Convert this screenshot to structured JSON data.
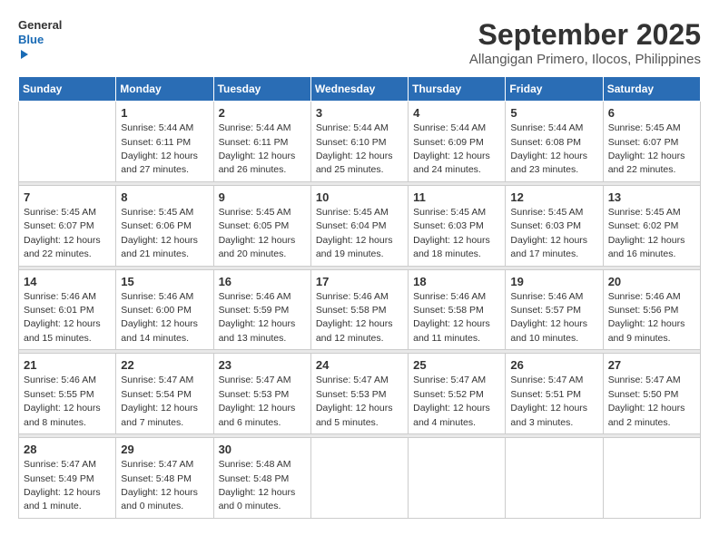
{
  "logo": {
    "line1": "General",
    "line2": "Blue"
  },
  "title": "September 2025",
  "subtitle": "Allangigan Primero, Ilocos, Philippines",
  "headers": [
    "Sunday",
    "Monday",
    "Tuesday",
    "Wednesday",
    "Thursday",
    "Friday",
    "Saturday"
  ],
  "weeks": [
    [
      {
        "day": "",
        "text": ""
      },
      {
        "day": "1",
        "text": "Sunrise: 5:44 AM\nSunset: 6:11 PM\nDaylight: 12 hours\nand 27 minutes."
      },
      {
        "day": "2",
        "text": "Sunrise: 5:44 AM\nSunset: 6:11 PM\nDaylight: 12 hours\nand 26 minutes."
      },
      {
        "day": "3",
        "text": "Sunrise: 5:44 AM\nSunset: 6:10 PM\nDaylight: 12 hours\nand 25 minutes."
      },
      {
        "day": "4",
        "text": "Sunrise: 5:44 AM\nSunset: 6:09 PM\nDaylight: 12 hours\nand 24 minutes."
      },
      {
        "day": "5",
        "text": "Sunrise: 5:44 AM\nSunset: 6:08 PM\nDaylight: 12 hours\nand 23 minutes."
      },
      {
        "day": "6",
        "text": "Sunrise: 5:45 AM\nSunset: 6:07 PM\nDaylight: 12 hours\nand 22 minutes."
      }
    ],
    [
      {
        "day": "7",
        "text": "Sunrise: 5:45 AM\nSunset: 6:07 PM\nDaylight: 12 hours\nand 22 minutes."
      },
      {
        "day": "8",
        "text": "Sunrise: 5:45 AM\nSunset: 6:06 PM\nDaylight: 12 hours\nand 21 minutes."
      },
      {
        "day": "9",
        "text": "Sunrise: 5:45 AM\nSunset: 6:05 PM\nDaylight: 12 hours\nand 20 minutes."
      },
      {
        "day": "10",
        "text": "Sunrise: 5:45 AM\nSunset: 6:04 PM\nDaylight: 12 hours\nand 19 minutes."
      },
      {
        "day": "11",
        "text": "Sunrise: 5:45 AM\nSunset: 6:03 PM\nDaylight: 12 hours\nand 18 minutes."
      },
      {
        "day": "12",
        "text": "Sunrise: 5:45 AM\nSunset: 6:03 PM\nDaylight: 12 hours\nand 17 minutes."
      },
      {
        "day": "13",
        "text": "Sunrise: 5:45 AM\nSunset: 6:02 PM\nDaylight: 12 hours\nand 16 minutes."
      }
    ],
    [
      {
        "day": "14",
        "text": "Sunrise: 5:46 AM\nSunset: 6:01 PM\nDaylight: 12 hours\nand 15 minutes."
      },
      {
        "day": "15",
        "text": "Sunrise: 5:46 AM\nSunset: 6:00 PM\nDaylight: 12 hours\nand 14 minutes."
      },
      {
        "day": "16",
        "text": "Sunrise: 5:46 AM\nSunset: 5:59 PM\nDaylight: 12 hours\nand 13 minutes."
      },
      {
        "day": "17",
        "text": "Sunrise: 5:46 AM\nSunset: 5:58 PM\nDaylight: 12 hours\nand 12 minutes."
      },
      {
        "day": "18",
        "text": "Sunrise: 5:46 AM\nSunset: 5:58 PM\nDaylight: 12 hours\nand 11 minutes."
      },
      {
        "day": "19",
        "text": "Sunrise: 5:46 AM\nSunset: 5:57 PM\nDaylight: 12 hours\nand 10 minutes."
      },
      {
        "day": "20",
        "text": "Sunrise: 5:46 AM\nSunset: 5:56 PM\nDaylight: 12 hours\nand 9 minutes."
      }
    ],
    [
      {
        "day": "21",
        "text": "Sunrise: 5:46 AM\nSunset: 5:55 PM\nDaylight: 12 hours\nand 8 minutes."
      },
      {
        "day": "22",
        "text": "Sunrise: 5:47 AM\nSunset: 5:54 PM\nDaylight: 12 hours\nand 7 minutes."
      },
      {
        "day": "23",
        "text": "Sunrise: 5:47 AM\nSunset: 5:53 PM\nDaylight: 12 hours\nand 6 minutes."
      },
      {
        "day": "24",
        "text": "Sunrise: 5:47 AM\nSunset: 5:53 PM\nDaylight: 12 hours\nand 5 minutes."
      },
      {
        "day": "25",
        "text": "Sunrise: 5:47 AM\nSunset: 5:52 PM\nDaylight: 12 hours\nand 4 minutes."
      },
      {
        "day": "26",
        "text": "Sunrise: 5:47 AM\nSunset: 5:51 PM\nDaylight: 12 hours\nand 3 minutes."
      },
      {
        "day": "27",
        "text": "Sunrise: 5:47 AM\nSunset: 5:50 PM\nDaylight: 12 hours\nand 2 minutes."
      }
    ],
    [
      {
        "day": "28",
        "text": "Sunrise: 5:47 AM\nSunset: 5:49 PM\nDaylight: 12 hours\nand 1 minute."
      },
      {
        "day": "29",
        "text": "Sunrise: 5:47 AM\nSunset: 5:48 PM\nDaylight: 12 hours\nand 0 minutes."
      },
      {
        "day": "30",
        "text": "Sunrise: 5:48 AM\nSunset: 5:48 PM\nDaylight: 12 hours\nand 0 minutes."
      },
      {
        "day": "",
        "text": ""
      },
      {
        "day": "",
        "text": ""
      },
      {
        "day": "",
        "text": ""
      },
      {
        "day": "",
        "text": ""
      }
    ]
  ]
}
